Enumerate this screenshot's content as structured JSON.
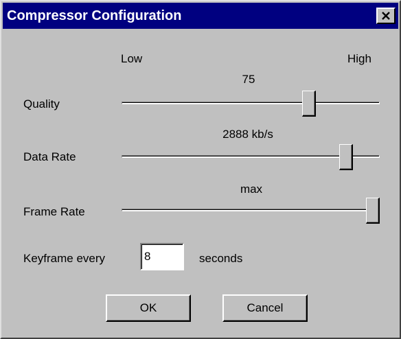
{
  "window": {
    "title": "Compressor Configuration",
    "close_icon": "close-icon"
  },
  "scale": {
    "low_label": "Low",
    "high_label": "High"
  },
  "sliders": [
    {
      "label": "Quality",
      "value_text": "75",
      "level": 0.74
    },
    {
      "label": "Data Rate",
      "value_text": "2888 kb/s",
      "level": 0.89
    },
    {
      "label": "Frame Rate",
      "value_text": "max",
      "level": 1.0
    }
  ],
  "keyframe": {
    "label": "Keyframe every",
    "value": "8",
    "unit": "seconds"
  },
  "buttons": {
    "ok": "OK",
    "cancel": "Cancel"
  },
  "colors": {
    "title_bar": "#000080",
    "face": "#c0c0c0"
  }
}
